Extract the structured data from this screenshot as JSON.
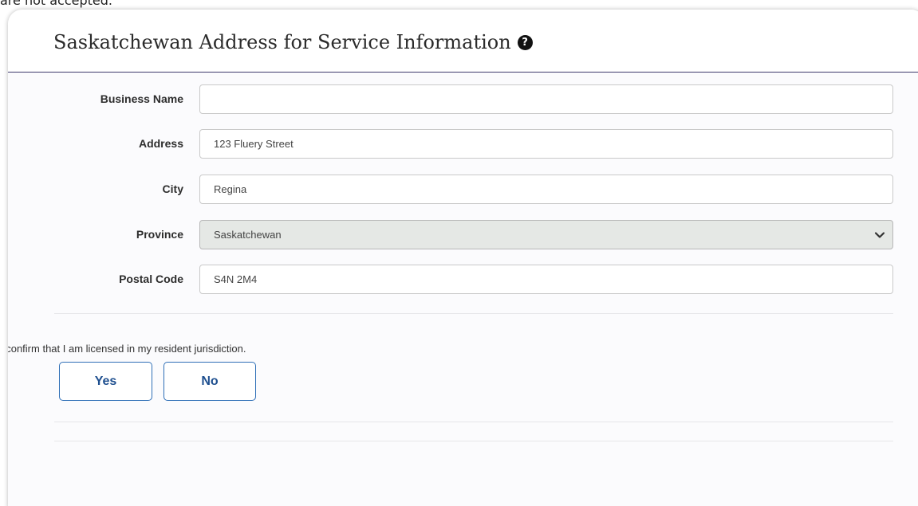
{
  "page": {
    "top_fragment": "are not accepted."
  },
  "section": {
    "title": "Saskatchewan Address for Service Information",
    "help_icon": "question-circle-icon"
  },
  "form": {
    "business_name": {
      "label": "Business Name",
      "value": ""
    },
    "address": {
      "label": "Address",
      "value": "123 Fluery Street"
    },
    "city": {
      "label": "City",
      "value": "Regina"
    },
    "province": {
      "label": "Province",
      "value": "Saskatchewan",
      "icon": "chevron-down-icon"
    },
    "postal_code": {
      "label": "Postal Code",
      "value": "S4N 2M4"
    }
  },
  "confirm": {
    "text": "I confirm that I am licensed in my resident jurisdiction.",
    "yes_label": "Yes",
    "no_label": "No"
  },
  "colors": {
    "header_rule": "#3e3a6b",
    "button_border": "#2f6fb7",
    "button_text": "#1e4f8f",
    "select_bg": "#e5e8e5"
  }
}
